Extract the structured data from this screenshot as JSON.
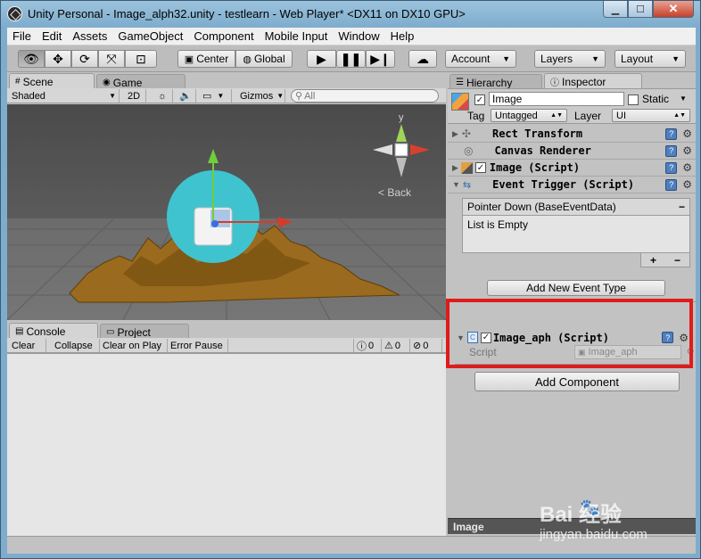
{
  "window": {
    "title": "Unity Personal - Image_alph32.unity - testlearn - Web Player* <DX11 on DX10 GPU>",
    "min_glyph": "▁",
    "max_glyph": "☐",
    "close_glyph": "✕"
  },
  "menu": [
    "File",
    "Edit",
    "Assets",
    "GameObject",
    "Component",
    "Mobile Input",
    "Window",
    "Help"
  ],
  "toolbar": {
    "center_label": "Center",
    "global_label": "Global",
    "account_label": "Account",
    "layers_label": "Layers",
    "layout_label": "Layout"
  },
  "scene": {
    "tabs": [
      "Scene",
      "Game"
    ],
    "shading_mode": "Shaded",
    "mode_2d": "2D",
    "gizmos_label": "Gizmos",
    "search_placeholder": "All",
    "gizmo_y": "y",
    "back_label": "Back"
  },
  "console": {
    "tabs": [
      "Console",
      "Project"
    ],
    "buttons": [
      "Clear",
      "Collapse",
      "Clear on Play",
      "Error Pause"
    ],
    "info_count": "0",
    "warn_count": "0",
    "error_count": "0"
  },
  "inspector": {
    "tabs": [
      "Hierarchy",
      "Inspector"
    ],
    "object_name": "Image",
    "static_label": "Static",
    "tag_label": "Tag",
    "tag_value": "Untagged",
    "layer_label": "Layer",
    "layer_value": "UI",
    "components": [
      {
        "name": "Rect Transform"
      },
      {
        "name": "Canvas Renderer"
      },
      {
        "name": "Image (Script)"
      },
      {
        "name": "Event Trigger (Script)"
      }
    ],
    "event_trigger": {
      "entry_title": "Pointer Down (BaseEventData)",
      "list_text": "List is Empty",
      "add_label": "Add New Event Type"
    },
    "script_component": {
      "name": "Image_aph (Script)",
      "script_label": "Script",
      "script_value": "Image_aph"
    },
    "add_component_label": "Add Component",
    "preview_label": "Image"
  },
  "watermark": {
    "brand": "Bai  经验",
    "url": "jingyan.baidu.com"
  },
  "colors": {
    "highlight": "#e01b1b",
    "circle": "#3fc4cf",
    "terrain": "#9a6a1e"
  }
}
